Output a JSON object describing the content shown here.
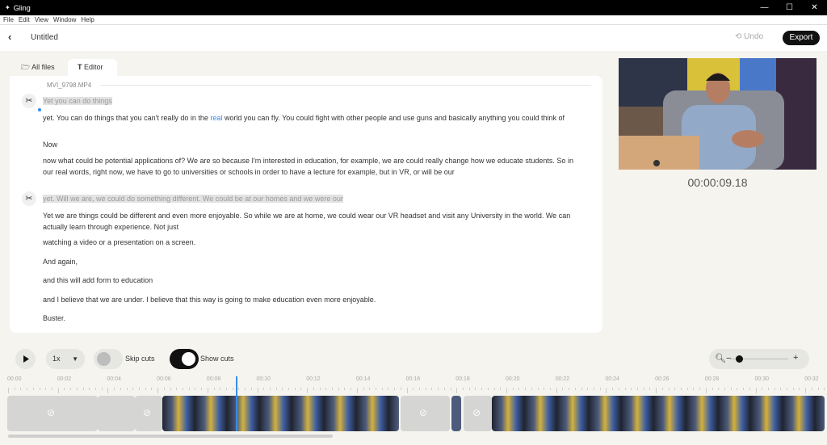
{
  "app": {
    "title": "Gling",
    "icon": "gling-logo-icon"
  },
  "window_controls": [
    "—",
    "☐",
    "✕"
  ],
  "menu": [
    "File",
    "Edit",
    "View",
    "Window",
    "Help"
  ],
  "header": {
    "back": "‹",
    "title": "Untitled",
    "undo": "Undo",
    "export": "Export"
  },
  "tabs": {
    "files": "All files",
    "editor": "Editor"
  },
  "editor": {
    "filename": "MVI_9798.MP4",
    "paragraphs": [
      {
        "text": "Yet you can do things",
        "cut": true
      },
      {
        "pre": "yet. You can do things that you can't really do in the ",
        "link": "real",
        "post": " world you can fly. You could fight with other people and use guns and basically anything you could think of",
        "cut": false
      },
      {
        "text": "Now",
        "cut": false
      },
      {
        "text": "now what could be potential applications of? We are so because I'm interested in education, for example, we are could really change how we educate students. So in our real words, right now, we have to go to universities or schools in order to have a lecture for example, but in VR, or will be our",
        "cut": false
      },
      {
        "text": "yet. Will we are, we could do something different. We could be at our homes and we were our",
        "cut": true
      },
      {
        "text": "Yet we are things could be different and even more enjoyable. So while we are at home, we could wear our VR headset and visit any University in the world. We can actually learn through experience. Not just",
        "cut": false
      },
      {
        "text": "watching a video or a presentation on a screen.",
        "cut": false
      },
      {
        "text": "And again,",
        "cut": false
      },
      {
        "text": "and this will add form to education",
        "cut": false
      },
      {
        "text": "and I believe that we are under. I believe that this way is going to make education even more enjoyable.",
        "cut": false
      },
      {
        "text": "Buster.",
        "cut": false
      }
    ]
  },
  "preview": {
    "timecode": "00:00:09.18"
  },
  "controls": {
    "speed": "1x",
    "skip_cuts": "Skip cuts",
    "show_cuts": "Show cuts"
  },
  "timeline": {
    "ticks": [
      "00:00",
      "00:02",
      "00:04",
      "00:06",
      "00:08",
      "00:10",
      "00:12",
      "00:14",
      "00:16",
      "00:18",
      "00:20",
      "00:22",
      "00:24",
      "00:26",
      "00:28",
      "00:30",
      "00:32"
    ]
  }
}
